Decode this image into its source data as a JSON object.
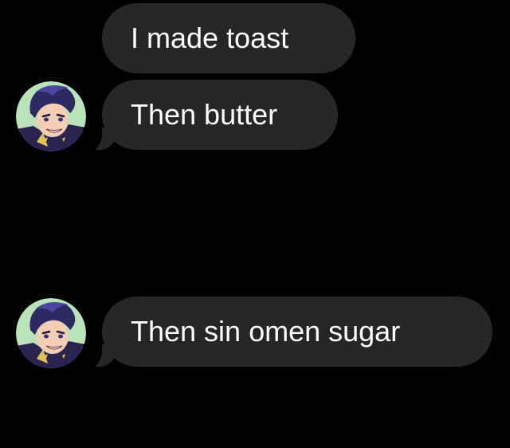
{
  "conversation": {
    "messages": [
      {
        "text": "I made toast",
        "has_avatar": false
      },
      {
        "text": "Then butter",
        "has_avatar": true
      },
      {
        "text": "Then sin omen sugar",
        "has_avatar": true
      }
    ]
  },
  "colors": {
    "background": "#000000",
    "bubble": "#262628",
    "text": "#ffffff"
  },
  "icons": {
    "avatar": "anime-character-avatar"
  }
}
